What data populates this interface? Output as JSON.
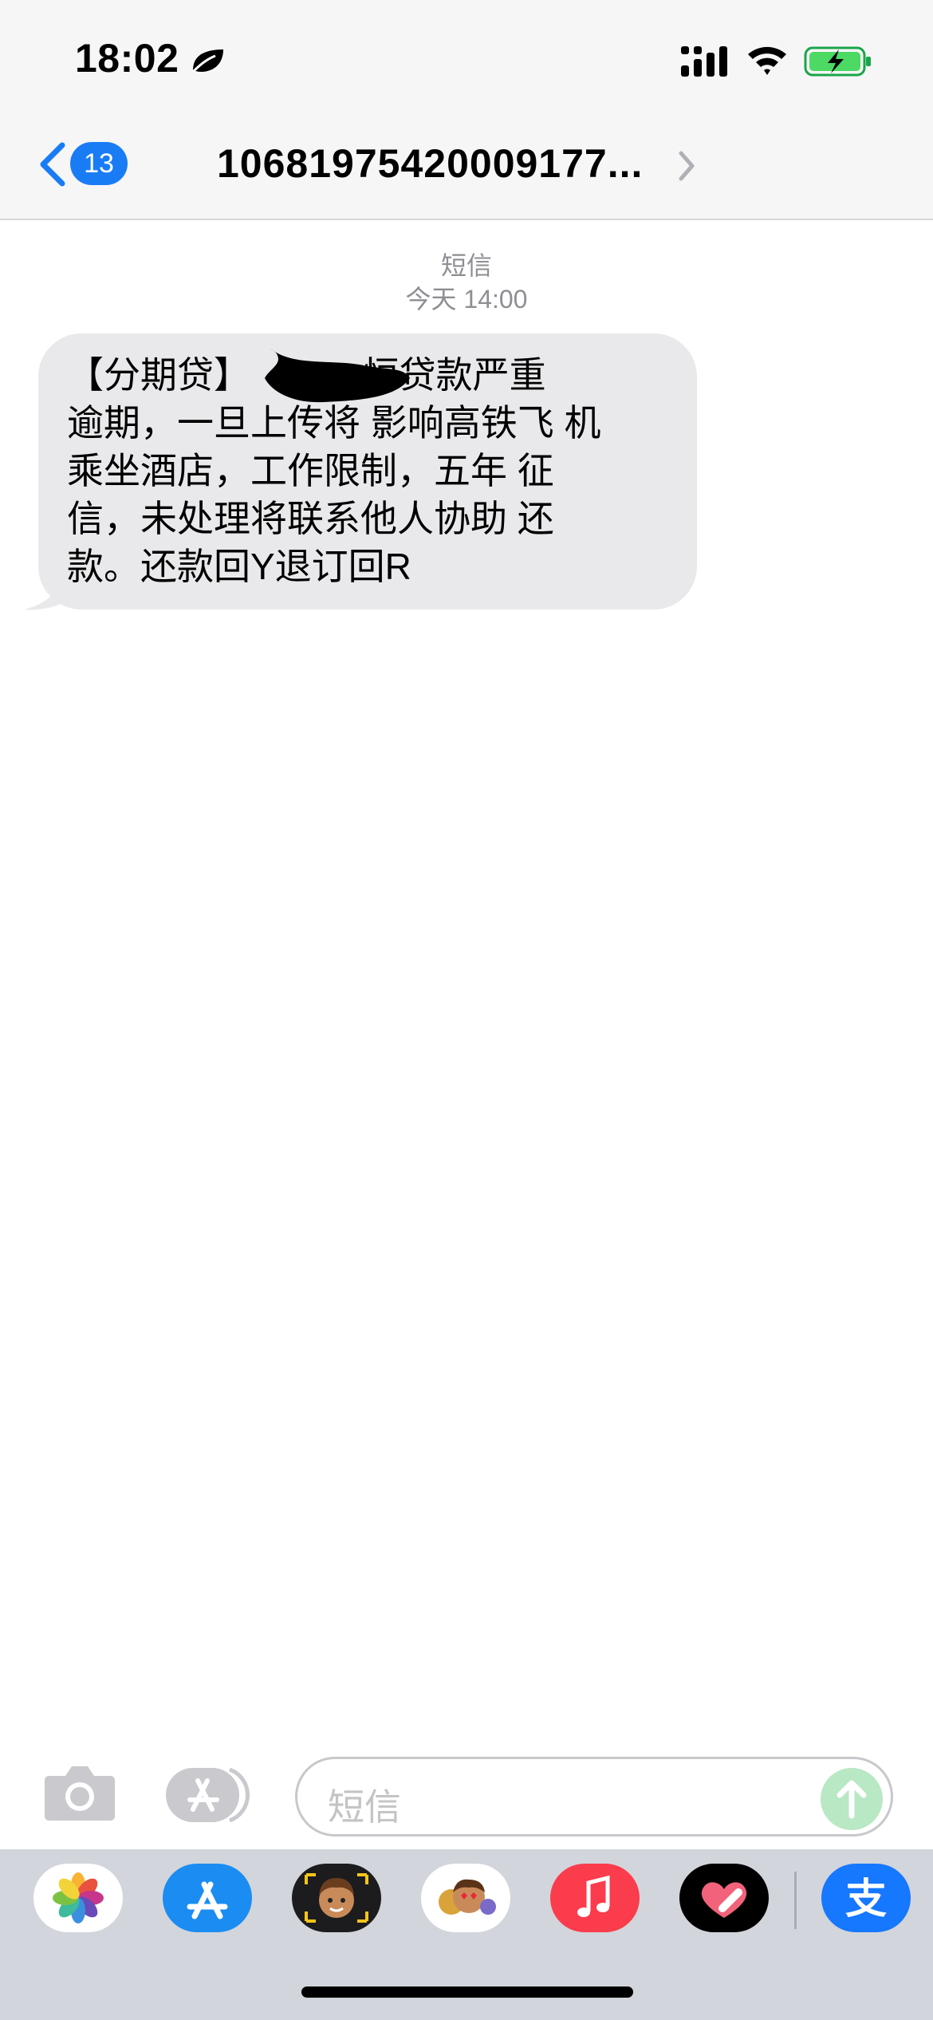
{
  "status_bar": {
    "time": "18:02",
    "icons": [
      "leaf-icon",
      "cellular-signal-icon",
      "wifi-icon",
      "battery-charging-icon"
    ]
  },
  "nav": {
    "back_count": "13",
    "title": "10681975420009177...",
    "back_icon": "chevron-left-icon",
    "title_icon": "chevron-right-icon"
  },
  "conversation": {
    "service": "短信",
    "timestamp": "今天 14:00",
    "message": {
      "lines": [
        "【分期贷】           恒贷款严重",
        "逾期，一旦上传将 影响高铁飞 机",
        "乘坐酒店，工作限制，五年 征",
        "信，未处理将联系他人协助 还",
        "款。还款回Y退订回R"
      ],
      "redacted": true
    }
  },
  "input_bar": {
    "placeholder": "短信",
    "icons": [
      "camera-icon",
      "app-store-icon",
      "send-arrow-icon"
    ]
  },
  "dock": {
    "apps": [
      {
        "name": "photos-app-icon"
      },
      {
        "name": "app-store-app-icon"
      },
      {
        "name": "memoji-app-icon"
      },
      {
        "name": "animoji-stickers-app-icon"
      },
      {
        "name": "music-app-icon"
      },
      {
        "name": "heart-app-icon"
      },
      {
        "name": "alipay-app-icon",
        "label": "支"
      }
    ]
  },
  "colors": {
    "accent_blue": "#1a7cf5",
    "bubble_gray": "#e9e9eb",
    "meta_gray": "#8e8e93",
    "send_green": "#b9e8c4",
    "battery_green": "#4cd964",
    "music_red": "#fa3c4c",
    "alipay_blue": "#1677ff"
  }
}
